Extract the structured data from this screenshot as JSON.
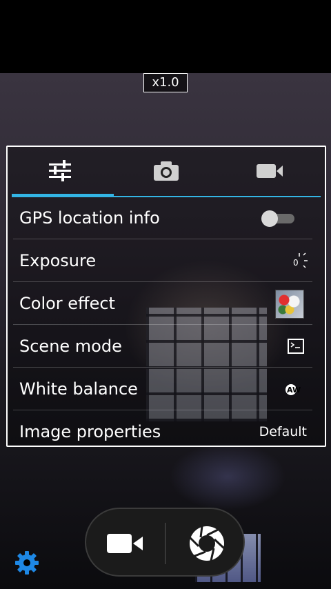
{
  "zoom": {
    "label": "x1.0"
  },
  "tabs": [
    {
      "icon": "sliders-icon",
      "selected": true
    },
    {
      "icon": "camera-icon",
      "selected": false
    },
    {
      "icon": "video-camera-icon",
      "selected": false
    }
  ],
  "settings": {
    "gps": {
      "label": "GPS location info",
      "enabled": false,
      "icon": "toggle-switch"
    },
    "exposure": {
      "label": "Exposure",
      "icon": "exposure-icon",
      "value_text": "0"
    },
    "color_effect": {
      "label": "Color effect",
      "icon": "color-effect-thumbnail"
    },
    "scene_mode": {
      "label": "Scene mode",
      "icon": "scene-mode-icon"
    },
    "white_balance": {
      "label": "White balance",
      "icon": "white-balance-auto-icon",
      "value_text": "AW"
    },
    "image_properties": {
      "label": "Image properties",
      "value": "Default"
    }
  },
  "controls": {
    "video_button_icon": "video-camera-icon",
    "shutter_button_icon": "shutter-aperture-icon",
    "settings_icon": "gear-icon"
  },
  "colors": {
    "accent": "#33b5e5",
    "settings_gear": "#1e88e5",
    "panel_border": "#ffffff",
    "text": "#ffffff"
  }
}
